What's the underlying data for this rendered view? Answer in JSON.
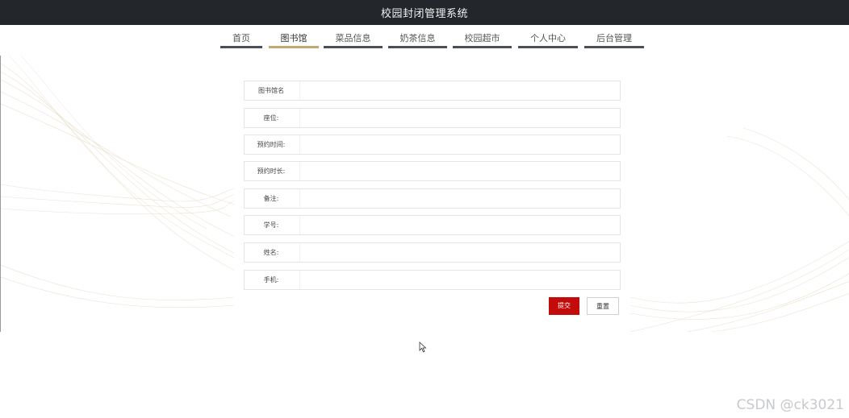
{
  "header": {
    "title": "校园封闭管理系统"
  },
  "nav": {
    "items": [
      {
        "label": "首页"
      },
      {
        "label": "图书馆"
      },
      {
        "label": "菜品信息"
      },
      {
        "label": "奶茶信息"
      },
      {
        "label": "校园超市"
      },
      {
        "label": "个人中心"
      },
      {
        "label": "后台管理"
      }
    ],
    "active": "图书馆"
  },
  "form": {
    "fields": [
      {
        "label": "图书馆名",
        "value": ""
      },
      {
        "label": "座位:",
        "value": ""
      },
      {
        "label": "预约时间:",
        "value": ""
      },
      {
        "label": "预约时长:",
        "value": ""
      },
      {
        "label": "备注:",
        "value": ""
      },
      {
        "label": "学号:",
        "value": ""
      },
      {
        "label": "姓名:",
        "value": ""
      },
      {
        "label": "手机:",
        "value": ""
      }
    ],
    "submit_label": "提交",
    "reset_label": "重置"
  },
  "colors": {
    "header_bg": "#23262b",
    "nav_underline": "#4b4f58",
    "nav_active_underline": "#c6a772",
    "submit_bg": "#c40b0b"
  },
  "watermark": "CSDN @ck3021"
}
